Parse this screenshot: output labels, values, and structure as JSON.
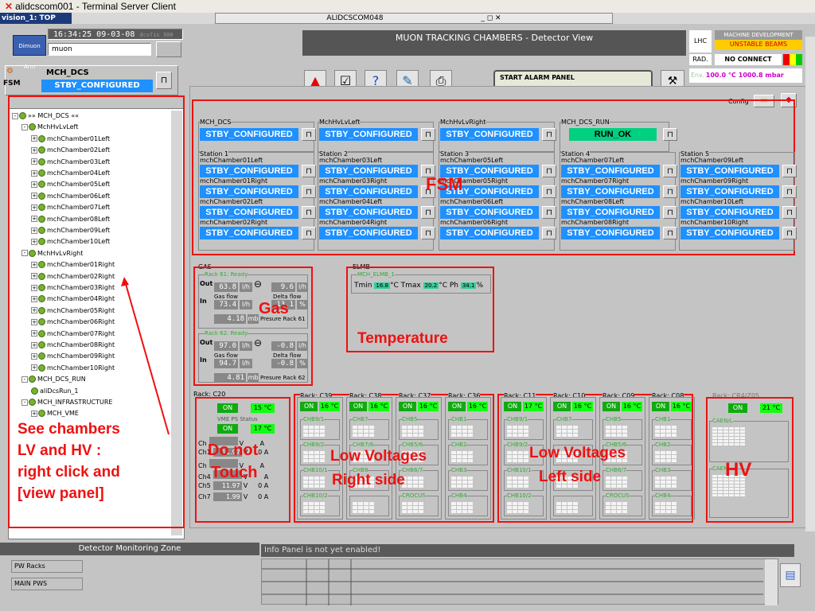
{
  "window": {
    "title": "alidcscom001 - Terminal Server Client"
  },
  "tab": {
    "label": "vision_1: TOP",
    "center_title": "ALIDCSCOM048",
    "controls": "_  &#9633;  ×"
  },
  "left": {
    "clock": "16:34:25 09-03-08",
    "clock_user": "dcsfis 300",
    "logo": "Dimuon Arm",
    "user": "muon",
    "fsm_label": "FSM",
    "fsm_node": "MCH_DCS",
    "fsm_state": "STBY_CONFIGURED"
  },
  "tree": [
    {
      "label": "»» MCH_DCS «« ",
      "indent": 0,
      "pm": "-"
    },
    {
      "label": "MchHvLvLeft",
      "indent": 1,
      "pm": "-"
    },
    {
      "label": "mchChamber01Left",
      "indent": 2,
      "pm": "+"
    },
    {
      "label": "mchChamber02Left",
      "indent": 2,
      "pm": "+"
    },
    {
      "label": "mchChamber03Left",
      "indent": 2,
      "pm": "+"
    },
    {
      "label": "mchChamber04Left",
      "indent": 2,
      "pm": "+"
    },
    {
      "label": "mchChamber05Left",
      "indent": 2,
      "pm": "+"
    },
    {
      "label": "mchChamber06Left",
      "indent": 2,
      "pm": "+"
    },
    {
      "label": "mchChamber07Left",
      "indent": 2,
      "pm": "+"
    },
    {
      "label": "mchChamber08Left",
      "indent": 2,
      "pm": "+"
    },
    {
      "label": "mchChamber09Left",
      "indent": 2,
      "pm": "+"
    },
    {
      "label": "mchChamber10Left",
      "indent": 2,
      "pm": "+"
    },
    {
      "label": "MchHvLvRight",
      "indent": 1,
      "pm": "-"
    },
    {
      "label": "mchChamber01Right",
      "indent": 2,
      "pm": "+"
    },
    {
      "label": "mchChamber02Right",
      "indent": 2,
      "pm": "+"
    },
    {
      "label": "mchChamber03Right",
      "indent": 2,
      "pm": "+"
    },
    {
      "label": "mchChamber04Right",
      "indent": 2,
      "pm": "+"
    },
    {
      "label": "mchChamber05Right",
      "indent": 2,
      "pm": "+"
    },
    {
      "label": "mchChamber06Right",
      "indent": 2,
      "pm": "+"
    },
    {
      "label": "mchChamber07Right",
      "indent": 2,
      "pm": "+"
    },
    {
      "label": "mchChamber08Right",
      "indent": 2,
      "pm": "+"
    },
    {
      "label": "mchChamber09Right",
      "indent": 2,
      "pm": "+"
    },
    {
      "label": "mchChamber10Right",
      "indent": 2,
      "pm": "+"
    },
    {
      "label": "MCH_DCS_RUN",
      "indent": 1,
      "pm": "-"
    },
    {
      "label": "aliDcsRun_1",
      "indent": 2,
      "pm": ""
    },
    {
      "label": "MCH_INFRASTRUCTURE",
      "indent": 1,
      "pm": "-"
    },
    {
      "label": "MCH_VME",
      "indent": 2,
      "pm": "+"
    }
  ],
  "header": {
    "title": "MUON TRACKING CHAMBERS - Detector View",
    "alarm_panel": "START ALARM PANEL",
    "lhc": "LHC",
    "machine_mode": "MACHINE DEVELOPMENT",
    "beam_state": "UNSTABLE BEAMS",
    "rad": "RAD.",
    "rad_status": "NO CONNECT",
    "env_label": "Env.",
    "env_temp": "100.0 °C",
    "env_pressure": "1000.8 mbar",
    "config": "Config"
  },
  "fsm": {
    "top": [
      {
        "group": "MCH_DCS",
        "state": "STBY_CONFIGURED",
        "color": "blue"
      },
      {
        "group": "MchHvLvLeft",
        "state": "STBY_CONFIGURED",
        "color": "blue"
      },
      {
        "group": "MchHvLvRight",
        "state": "STBY_CONFIGURED",
        "color": "blue"
      },
      {
        "group": "MCH_DCS_RUN",
        "state": "RUN_OK",
        "color": "green"
      }
    ],
    "stations": [
      {
        "title": "Station 1",
        "chambers": [
          "mchChamber01Left",
          "mchChamber01Right",
          "mchChamber02Left",
          "mchChamber02Right"
        ]
      },
      {
        "title": "Station 2",
        "chambers": [
          "mchChamber03Left",
          "mchChamber03Right",
          "mchChamber04Left",
          "mchChamber04Right"
        ]
      },
      {
        "title": "Station 3",
        "chambers": [
          "mchChamber05Left",
          "mchChamber05Right",
          "mchChamber06Left",
          "mchChamber06Right"
        ]
      },
      {
        "title": "Station 4",
        "chambers": [
          "mchChamber07Left",
          "mchChamber07Right",
          "mchChamber08Left",
          "mchChamber08Right"
        ]
      },
      {
        "title": "Station 5",
        "chambers": [
          "mchChamber09Left",
          "mchChamber09Right",
          "mchChamber10Left",
          "mchChamber10Right"
        ]
      }
    ],
    "chamber_state": "STBY_CONFIGURED"
  },
  "gas": {
    "title": "GAS",
    "rack1": {
      "name": "Rack 61: Ready",
      "out": "63.8",
      "gasflow": "73.4",
      "delta1": "9.6",
      "delta2": "13.1",
      "pressure": "4.18",
      "pressure_label": "Presure Rack 61"
    },
    "rack2": {
      "name": "Rack 62: Ready",
      "out": "97.0",
      "gasflow": "94.7",
      "delta1": "-0.8",
      "delta2": "-0.8",
      "pressure": "4.81",
      "pressure_label": "Presure Rack 62"
    },
    "out_label": "Out",
    "in_label": "In",
    "gasflow_label": "Gas flow",
    "delta_label": "Delta flow",
    "unit_lh": "l/h",
    "unit_pct": "%",
    "unit_mb": "mb"
  },
  "elmb": {
    "title": "ELMB",
    "name": "MCH_ELMB_1",
    "tmin_label": "Tmin",
    "tmin": "16.8",
    "tmax_label": "°C Tmax",
    "tmax": "20.2",
    "ph_label": "°C Ph",
    "ph": "34.1",
    "ph_unit": "%"
  },
  "vme": {
    "rack": "Rack: C20",
    "on": "ON",
    "temp1": "15 °C",
    "status_label": "VME PS Status",
    "temp2": "17 °C",
    "channels": [
      {
        "ch": "Ch",
        "v": "",
        "a": "A"
      },
      {
        "ch": "Ch1",
        "v": "11.97",
        "a": "0 A"
      },
      {
        "ch": "Ch",
        "v": "",
        "a": "A"
      },
      {
        "ch": "Ch4",
        "v": "",
        "a": "A"
      },
      {
        "ch": "Ch5",
        "v": "11.97",
        "a": "0 A"
      },
      {
        "ch": "Ch7",
        "v": "1.99",
        "a": "0 A"
      }
    ],
    "unit_v": "V"
  },
  "lv_right": [
    {
      "rack": "Rack: C39",
      "on": "ON",
      "temp": "16 °C",
      "cards": [
        "CHB9/1",
        "CHB9/2",
        "CHB10/1",
        "CHB10/2"
      ]
    },
    {
      "rack": "Rack: C38",
      "on": "ON",
      "temp": "16 °C",
      "cards": [
        "CHB7",
        "CHB7/8",
        "CHB8",
        ""
      ]
    },
    {
      "rack": "Rack: C37",
      "on": "ON",
      "temp": "16 °C",
      "cards": [
        "CHB5",
        "CHB5/6",
        "CHB6/7",
        "CROCUS"
      ]
    },
    {
      "rack": "Rack: C36",
      "on": "ON",
      "temp": "16 °C",
      "cards": [
        "CHB1",
        "CHB2",
        "CHB3",
        "CHB4"
      ]
    }
  ],
  "lv_left": [
    {
      "rack": "Rack: C11",
      "on": "ON",
      "temp": "17 °C",
      "cards": [
        "CHB9/1",
        "CHB9/2",
        "CHB10/1",
        "CHB10/2"
      ]
    },
    {
      "rack": "Rack: C10",
      "on": "ON",
      "temp": "16 °C",
      "cards": [
        "CHB7",
        "",
        "",
        ""
      ]
    },
    {
      "rack": "Rack: C09",
      "on": "ON",
      "temp": "16 °C",
      "cards": [
        "CHB5",
        "CHB5/6",
        "CHB6/7",
        "CROCUS"
      ]
    },
    {
      "rack": "Rack: C08",
      "on": "ON",
      "temp": "16 °C",
      "cards": [
        "CHB1",
        "CHB2",
        "CHB3",
        "CHB4"
      ]
    }
  ],
  "hv": {
    "rack": "Rack: CR4/Z05",
    "on": "ON",
    "temp": "21 °C",
    "caen1": "CAEN/L",
    "caen2": "CAEN"
  },
  "annotations": {
    "fsm": "FSM",
    "gas": "Gas",
    "temperature": "Temperature",
    "donot1": "Do not",
    "donot2": "Touch",
    "lvr1": "Low Voltages",
    "lvr2": "Right side",
    "lvl1": "Low Voltages",
    "lvl2": "Left side",
    "hv": "HV",
    "see1": "See chambers",
    "see2": "LV and HV :",
    "see3": "right click  and",
    "see4": "[view panel]"
  },
  "bottom": {
    "dmz_title": "Detector Monitoring Zone",
    "pw_racks": "PW Racks",
    "main_pws": "MAIN PWS",
    "info": "Info Panel is not yet enabled!"
  }
}
